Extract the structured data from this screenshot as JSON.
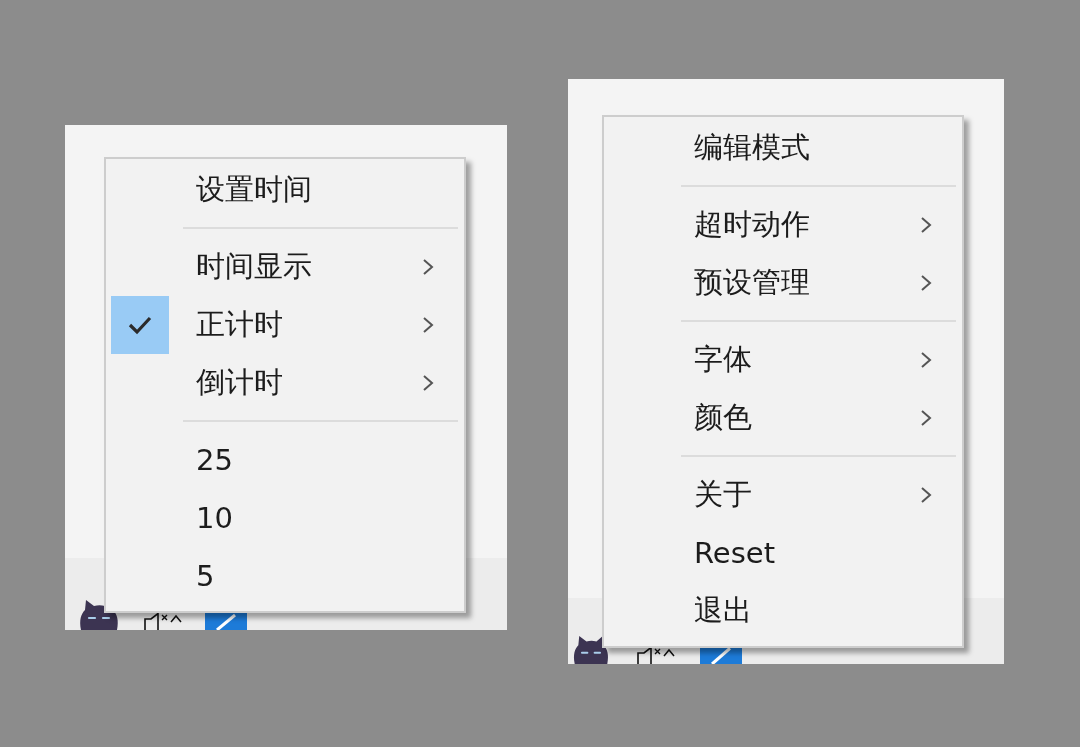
{
  "panels": [
    {
      "menu": {
        "items": [
          {
            "kind": "item",
            "label": "设置时间",
            "checked": false,
            "submenu": false
          },
          {
            "kind": "separator"
          },
          {
            "kind": "item",
            "label": "时间显示",
            "checked": false,
            "submenu": true
          },
          {
            "kind": "item",
            "label": "正计时",
            "checked": true,
            "submenu": true
          },
          {
            "kind": "item",
            "label": "倒计时",
            "checked": false,
            "submenu": true
          },
          {
            "kind": "separator"
          },
          {
            "kind": "item",
            "label": "25",
            "checked": false,
            "submenu": false
          },
          {
            "kind": "item",
            "label": "10",
            "checked": false,
            "submenu": false
          },
          {
            "kind": "item",
            "label": "5",
            "checked": false,
            "submenu": false
          }
        ]
      }
    },
    {
      "menu": {
        "items": [
          {
            "kind": "item",
            "label": "编辑模式",
            "checked": false,
            "submenu": false
          },
          {
            "kind": "separator"
          },
          {
            "kind": "item",
            "label": "超时动作",
            "checked": false,
            "submenu": true
          },
          {
            "kind": "item",
            "label": "预设管理",
            "checked": false,
            "submenu": true
          },
          {
            "kind": "separator"
          },
          {
            "kind": "item",
            "label": "字体",
            "checked": false,
            "submenu": true
          },
          {
            "kind": "item",
            "label": "颜色",
            "checked": false,
            "submenu": true
          },
          {
            "kind": "separator"
          },
          {
            "kind": "item",
            "label": "关于",
            "checked": false,
            "submenu": true
          },
          {
            "kind": "item",
            "label": "Reset",
            "checked": false,
            "submenu": false
          },
          {
            "kind": "item",
            "label": "退出",
            "checked": false,
            "submenu": false
          }
        ]
      }
    }
  ]
}
